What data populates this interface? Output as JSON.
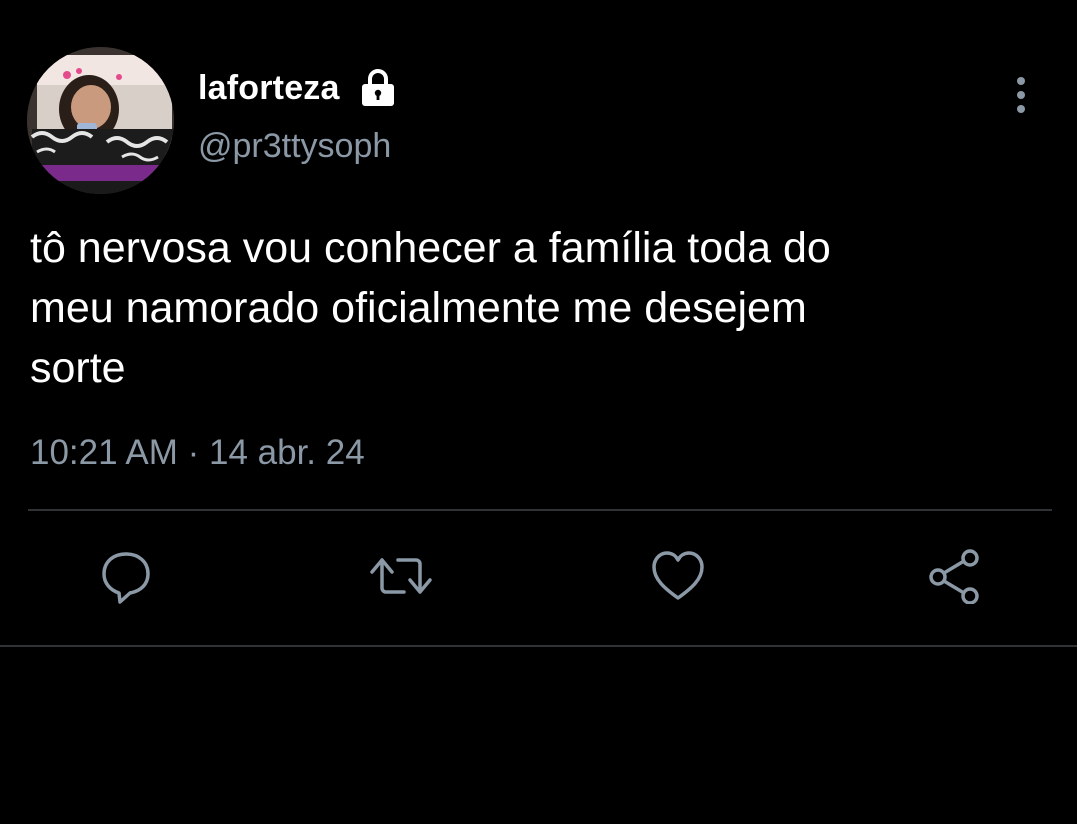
{
  "user": {
    "display_name": "laforteza",
    "handle": "@pr3ttysoph",
    "protected_icon": "lock-icon"
  },
  "tweet": {
    "text": "tô nervosa vou conhecer a família toda do\nmeu namorado oficialmente me desejem\nsorte",
    "timestamp": "10:21 AM · 14 abr. 24"
  },
  "actions": {
    "reply_icon": "reply-icon",
    "retweet_icon": "retweet-icon",
    "like_icon": "heart-icon",
    "share_icon": "share-icon",
    "more_icon": "more-vertical-icon"
  },
  "colors": {
    "background": "#000000",
    "primary_text": "#ffffff",
    "secondary_text": "#8b98a5",
    "divider": "#2f3336"
  }
}
